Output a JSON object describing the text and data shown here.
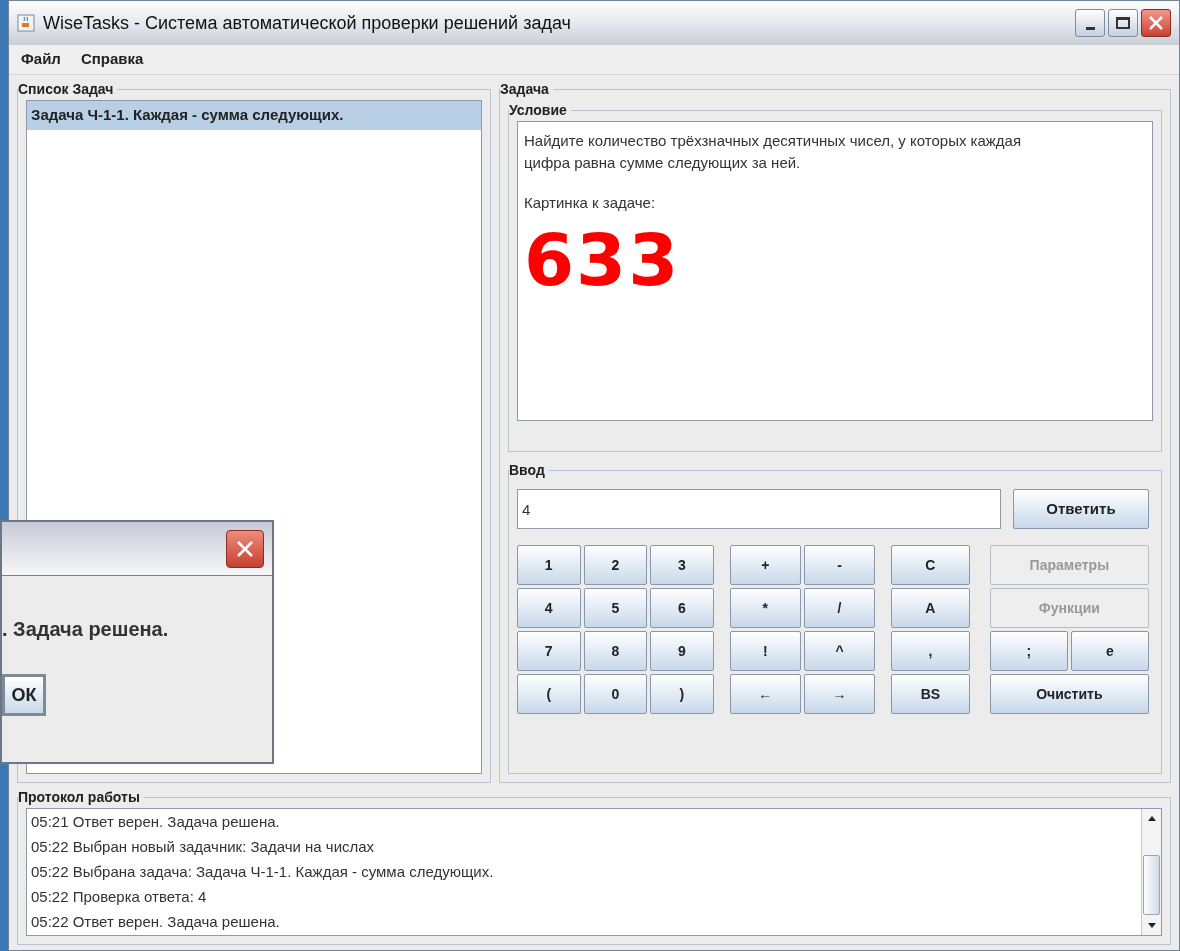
{
  "window": {
    "title": "WiseTasks - Система автоматической проверки решений задач"
  },
  "menu": [
    "Файл",
    "Справка"
  ],
  "task_list": {
    "title": "Список Задач",
    "items": [
      {
        "label": "Задача Ч-1-1. Каждая - сумма следующих.",
        "selected": true
      }
    ]
  },
  "task": {
    "title": "Задача",
    "condition": {
      "title": "Условие",
      "text": "Найдите количество трёхзначных десятичных чисел, у которых каждая цифра равна сумме следующих за ней.",
      "picture_caption": "Картинка к задаче:",
      "picture_text": "633"
    },
    "input": {
      "title": "Ввод",
      "value": "4",
      "submit": "Ответить",
      "groups": [
        {
          "kind": "digits",
          "buttons": [
            {
              "label": "1"
            },
            {
              "label": "2"
            },
            {
              "label": "3"
            },
            {
              "label": "4"
            },
            {
              "label": "5"
            },
            {
              "label": "6"
            },
            {
              "label": "7"
            },
            {
              "label": "8"
            },
            {
              "label": "9"
            },
            {
              "label": "("
            },
            {
              "label": "0"
            },
            {
              "label": ")"
            }
          ]
        },
        {
          "kind": "operators",
          "buttons": [
            {
              "label": "+"
            },
            {
              "label": "-"
            },
            {
              "label": "*"
            },
            {
              "label": "/"
            },
            {
              "label": "!"
            },
            {
              "label": "^"
            },
            {
              "label": "←"
            },
            {
              "label": "→"
            }
          ]
        },
        {
          "kind": "commands",
          "buttons": [
            {
              "label": "C"
            },
            {
              "label": "A"
            },
            {
              "label": ","
            },
            {
              "label": "BS"
            }
          ]
        }
      ],
      "side_rows": [
        [
          {
            "label": "Параметры",
            "disabled": true
          }
        ],
        [
          {
            "label": "Функции",
            "disabled": true
          }
        ],
        [
          {
            "label": ";",
            "disabled": false
          },
          {
            "label": "e",
            "disabled": false
          }
        ],
        [
          {
            "label": "Очистить",
            "disabled": false
          }
        ]
      ]
    }
  },
  "log": {
    "title": "Протокол работы",
    "lines": [
      "05:21 Ответ верен. Задача решена.",
      "05:22 Выбран новый задачник: Задачи на числах",
      "05:22 Выбрана задача: Задача Ч-1-1. Каждая - сумма следующих.",
      "05:22 Проверка ответа: 4",
      "05:22 Ответ верен. Задача решена."
    ]
  },
  "dialog": {
    "message": ". Задача решена.",
    "button": "ОК"
  }
}
